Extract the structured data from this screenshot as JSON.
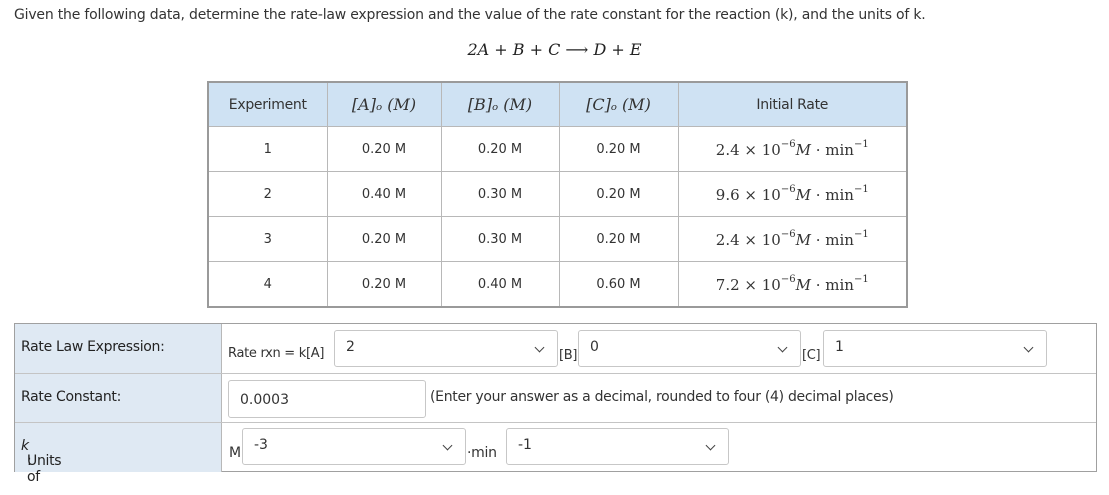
{
  "question": "Given the following data, determine the rate-law expression and the value of the rate constant for the reaction (k), and the units of k.",
  "equation": "2A + B + C ⟶ D + E",
  "table": {
    "headers": [
      "Experiment",
      "[A]ₒ (M)",
      "[B]ₒ (M)",
      "[C]ₒ (M)",
      "Initial Rate"
    ],
    "rows": [
      {
        "exp": "1",
        "a": "0.20 M",
        "b": "0.20 M",
        "c": "0.20 M",
        "rate_mant": "2.4 × 10",
        "rate_exp": "−6",
        "rate_unit": "M",
        "rate_tail": " · min",
        "rate_unit_exp": "−1"
      },
      {
        "exp": "2",
        "a": "0.40 M",
        "b": "0.30 M",
        "c": "0.20 M",
        "rate_mant": "9.6 × 10",
        "rate_exp": "−6",
        "rate_unit": "M",
        "rate_tail": " · min",
        "rate_unit_exp": "−1"
      },
      {
        "exp": "3",
        "a": "0.20 M",
        "b": "0.30 M",
        "c": "0.20 M",
        "rate_mant": "2.4 × 10",
        "rate_exp": "−6",
        "rate_unit": "M",
        "rate_tail": " · min",
        "rate_unit_exp": "−1"
      },
      {
        "exp": "4",
        "a": "0.20 M",
        "b": "0.40 M",
        "c": "0.60 M",
        "rate_mant": "7.2 × 10",
        "rate_exp": "−6",
        "rate_unit": "M",
        "rate_tail": " · min",
        "rate_unit_exp": "−1"
      }
    ]
  },
  "rate_law": {
    "label": "Rate Law Expression:",
    "prefix": "Rate rxn = k[A]",
    "a_order": "2",
    "b_label": "[B]",
    "b_order": "0",
    "c_label": "[C]",
    "c_order": "1"
  },
  "rate_constant": {
    "label": "Rate Constant:",
    "value": "0.0003",
    "hint": "(Enter your answer as a decimal, rounded to four (4) decimal places)"
  },
  "units": {
    "label_prefix": "Units of ",
    "label_var": "k",
    "label_suffix": ":",
    "m_label": "M",
    "m_exp": "-3",
    "min_label": "·min",
    "min_exp": "-1"
  },
  "icons": {
    "dropdown": "chevron-down-icon"
  }
}
